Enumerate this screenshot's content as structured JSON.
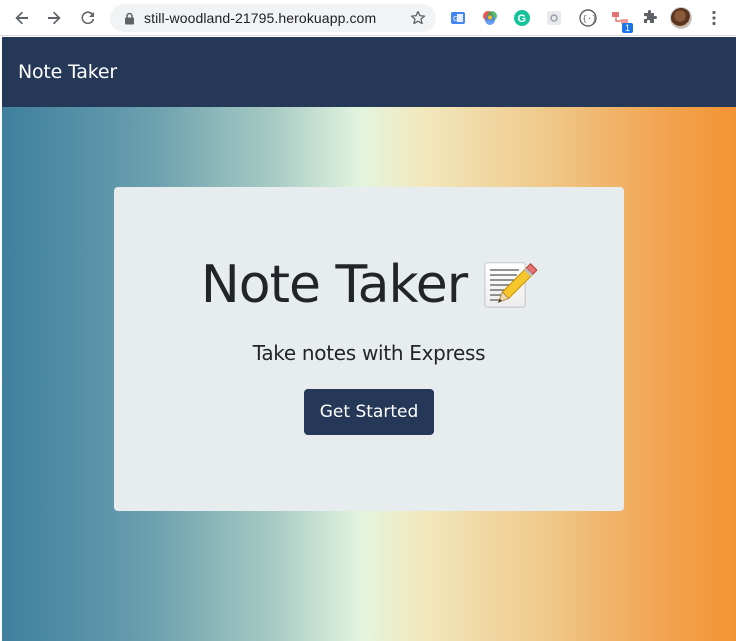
{
  "browser": {
    "url": "still-woodland-21795.herokuapp.com",
    "extensions": [
      {
        "name": "translate-extension-icon"
      },
      {
        "name": "color-picker-extension-icon"
      },
      {
        "name": "grammarly-extension-icon",
        "letter": "G"
      },
      {
        "name": "settings-extension-icon"
      },
      {
        "name": "code-extension-icon",
        "letter": "{···}"
      },
      {
        "name": "network-extension-icon",
        "badge": "1"
      },
      {
        "name": "puzzle-extensions-icon"
      }
    ]
  },
  "navbar": {
    "brand": "Note Taker",
    "color": "#253858"
  },
  "hero": {
    "gradient": [
      "#3f7f9e",
      "#a8cbc4",
      "#e3f5df",
      "#efcb8e",
      "#f39433"
    ]
  },
  "jumbotron": {
    "title": "Note Taker",
    "title_icon": "memo-icon",
    "lead": "Take notes with Express",
    "button_label": "Get Started"
  }
}
